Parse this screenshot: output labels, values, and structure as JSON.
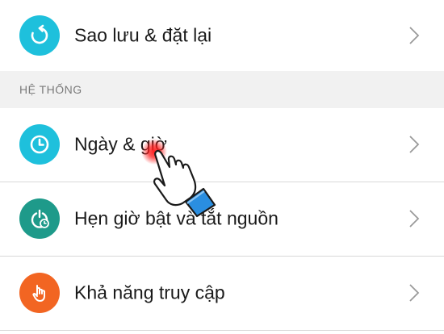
{
  "settings": {
    "rows": [
      {
        "label": "Sao lưu & đặt lại",
        "icon": "backup-restore-icon",
        "icon_color": "#1ec0dc"
      },
      {
        "label": "Ngày & giờ",
        "icon": "clock-icon",
        "icon_color": "#1ec0dc"
      },
      {
        "label": "Hẹn giờ bật và tắt nguồn",
        "icon": "power-timer-icon",
        "icon_color": "#1e9a8a"
      },
      {
        "label": "Khả năng truy cập",
        "icon": "accessibility-hand-icon",
        "icon_color": "#f26522"
      }
    ],
    "section_header": "HỆ THỐNG"
  },
  "colors": {
    "background": "#ffffff",
    "section_bg": "#f1f1f1",
    "divider": "#d8d8d8",
    "chevron": "#9a9a9a",
    "tap_highlight": "#ff2020"
  }
}
